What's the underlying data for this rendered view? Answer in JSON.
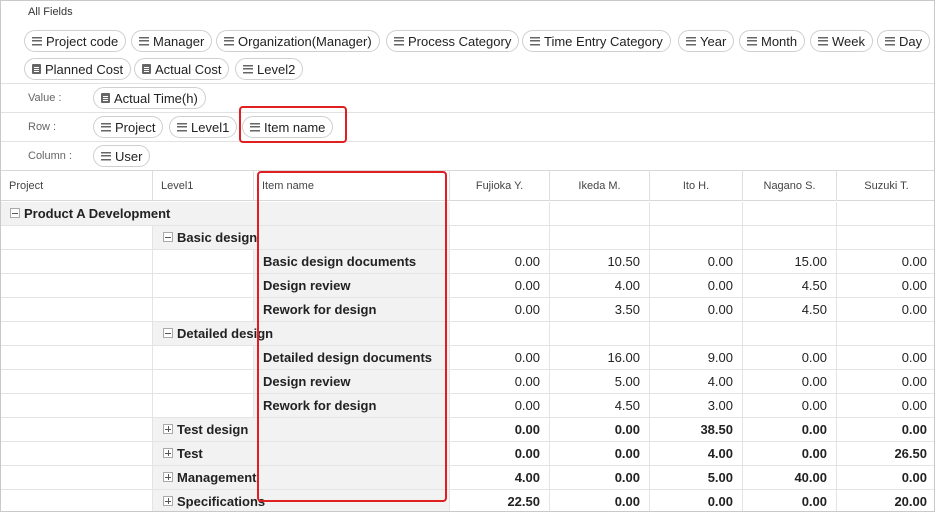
{
  "all_fields": {
    "title": "All Fields",
    "chips": [
      {
        "label": "Project code",
        "icon": "lines-icon"
      },
      {
        "label": "Manager",
        "icon": "lines-icon"
      },
      {
        "label": "Organization(Manager)",
        "icon": "lines-icon"
      },
      {
        "label": "Process Category",
        "icon": "lines-icon"
      },
      {
        "label": "Time Entry Category",
        "icon": "lines-icon"
      },
      {
        "label": "Year",
        "icon": "lines-icon"
      },
      {
        "label": "Month",
        "icon": "lines-icon"
      },
      {
        "label": "Week",
        "icon": "lines-icon"
      },
      {
        "label": "Day",
        "icon": "lines-icon"
      },
      {
        "label": "Planned Cost",
        "icon": "doc-icon"
      },
      {
        "label": "Actual Cost",
        "icon": "doc-icon"
      },
      {
        "label": "Level2",
        "icon": "lines-icon"
      }
    ]
  },
  "zones": {
    "value": {
      "label": "Value :",
      "chips": [
        "Actual Time(h)"
      ]
    },
    "row": {
      "label": "Row :",
      "chips": [
        "Project",
        "Level1",
        "Item name"
      ]
    },
    "column": {
      "label": "Column :",
      "chips": [
        "User"
      ]
    }
  },
  "grid": {
    "headers": [
      "Project",
      "Level1",
      "Item name",
      "Fujioka Y.",
      "Ikeda M.",
      "Ito H.",
      "Nagano S.",
      "Suzuki T."
    ],
    "rows": [
      {
        "type": "project",
        "label": "Product A Development",
        "values": [
          "",
          "",
          "",
          "",
          ""
        ]
      },
      {
        "type": "level1",
        "label": "Basic design",
        "expanded": true,
        "values": [
          "",
          "",
          "",
          "",
          ""
        ]
      },
      {
        "type": "item",
        "label": "Basic design documents",
        "values": [
          "0.00",
          "10.50",
          "0.00",
          "15.00",
          "0.00"
        ]
      },
      {
        "type": "item",
        "label": "Design review",
        "values": [
          "0.00",
          "4.00",
          "0.00",
          "4.50",
          "0.00"
        ]
      },
      {
        "type": "item",
        "label": "Rework for design",
        "values": [
          "0.00",
          "3.50",
          "0.00",
          "4.50",
          "0.00"
        ]
      },
      {
        "type": "level1",
        "label": "Detailed design",
        "expanded": true,
        "values": [
          "",
          "",
          "",
          "",
          ""
        ]
      },
      {
        "type": "item",
        "label": "Detailed design documents",
        "values": [
          "0.00",
          "16.00",
          "9.00",
          "0.00",
          "0.00"
        ]
      },
      {
        "type": "item",
        "label": "Design review",
        "values": [
          "0.00",
          "5.00",
          "4.00",
          "0.00",
          "0.00"
        ]
      },
      {
        "type": "item",
        "label": "Rework for design",
        "values": [
          "0.00",
          "4.50",
          "3.00",
          "0.00",
          "0.00"
        ]
      },
      {
        "type": "level1",
        "label": "Test design",
        "expanded": false,
        "values": [
          "0.00",
          "0.00",
          "38.50",
          "0.00",
          "0.00"
        ]
      },
      {
        "type": "level1",
        "label": "Test",
        "expanded": false,
        "values": [
          "0.00",
          "0.00",
          "4.00",
          "0.00",
          "26.50"
        ]
      },
      {
        "type": "level1",
        "label": "Management",
        "expanded": false,
        "values": [
          "4.00",
          "0.00",
          "5.00",
          "40.00",
          "0.00"
        ]
      },
      {
        "type": "level1",
        "label": "Specifications",
        "expanded": false,
        "values": [
          "22.50",
          "0.00",
          "0.00",
          "0.00",
          "20.00"
        ]
      }
    ]
  },
  "colors": {
    "highlight": "#e02020",
    "shade": "#f2f2f2"
  }
}
